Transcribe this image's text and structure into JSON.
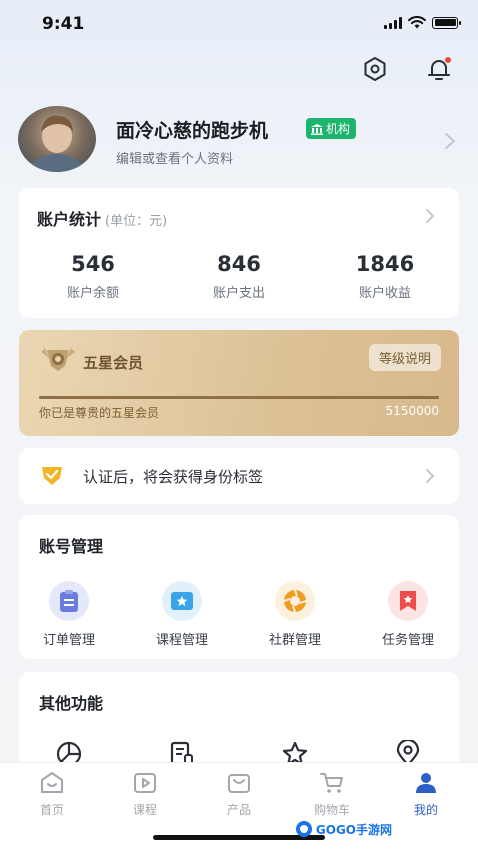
{
  "status_bar": {
    "time": "9:41"
  },
  "profile": {
    "name": "面冷心慈的跑步机",
    "badge": "机构",
    "subtitle": "编辑或查看个人资料"
  },
  "account_stats": {
    "title": "账户统计",
    "unit": "(单位：元)",
    "items": [
      {
        "value": "546",
        "label": "账户余额"
      },
      {
        "value": "846",
        "label": "账户支出"
      },
      {
        "value": "1846",
        "label": "账户收益"
      }
    ]
  },
  "vip": {
    "title": "五星会员",
    "button": "等级说明",
    "description": "你已是尊贵的五星会员",
    "value": "5150000",
    "progress": 1.0
  },
  "verify": {
    "text": "认证后，将会获得身份标签"
  },
  "account_management": {
    "title": "账号管理",
    "items": [
      {
        "label": "订单管理",
        "icon": "order-icon",
        "color": "#6b7be0"
      },
      {
        "label": "课程管理",
        "icon": "course-icon",
        "color": "#3aa4e8"
      },
      {
        "label": "社群管理",
        "icon": "community-icon",
        "color": "#f09a1e"
      },
      {
        "label": "任务管理",
        "icon": "task-icon",
        "color": "#ee4d4d"
      }
    ]
  },
  "other_functions": {
    "title": "其他功能",
    "items": [
      {
        "icon": "pie-chart-icon"
      },
      {
        "icon": "document-icon"
      },
      {
        "icon": "star-icon"
      },
      {
        "icon": "location-icon"
      }
    ]
  },
  "tabbar": {
    "items": [
      {
        "label": "首页",
        "icon": "home-icon",
        "active": false
      },
      {
        "label": "课程",
        "icon": "video-icon",
        "active": false
      },
      {
        "label": "产品",
        "icon": "bag-icon",
        "active": false
      },
      {
        "label": "购物车",
        "icon": "cart-icon",
        "active": false
      },
      {
        "label": "我的",
        "icon": "user-icon",
        "active": true
      }
    ]
  },
  "watermark": {
    "text": "GOGO手游网"
  },
  "colors": {
    "accent": "#2d5fc8",
    "badge": "#1db46e",
    "vip_gold": "#dcc196",
    "notification": "#f0453b"
  }
}
